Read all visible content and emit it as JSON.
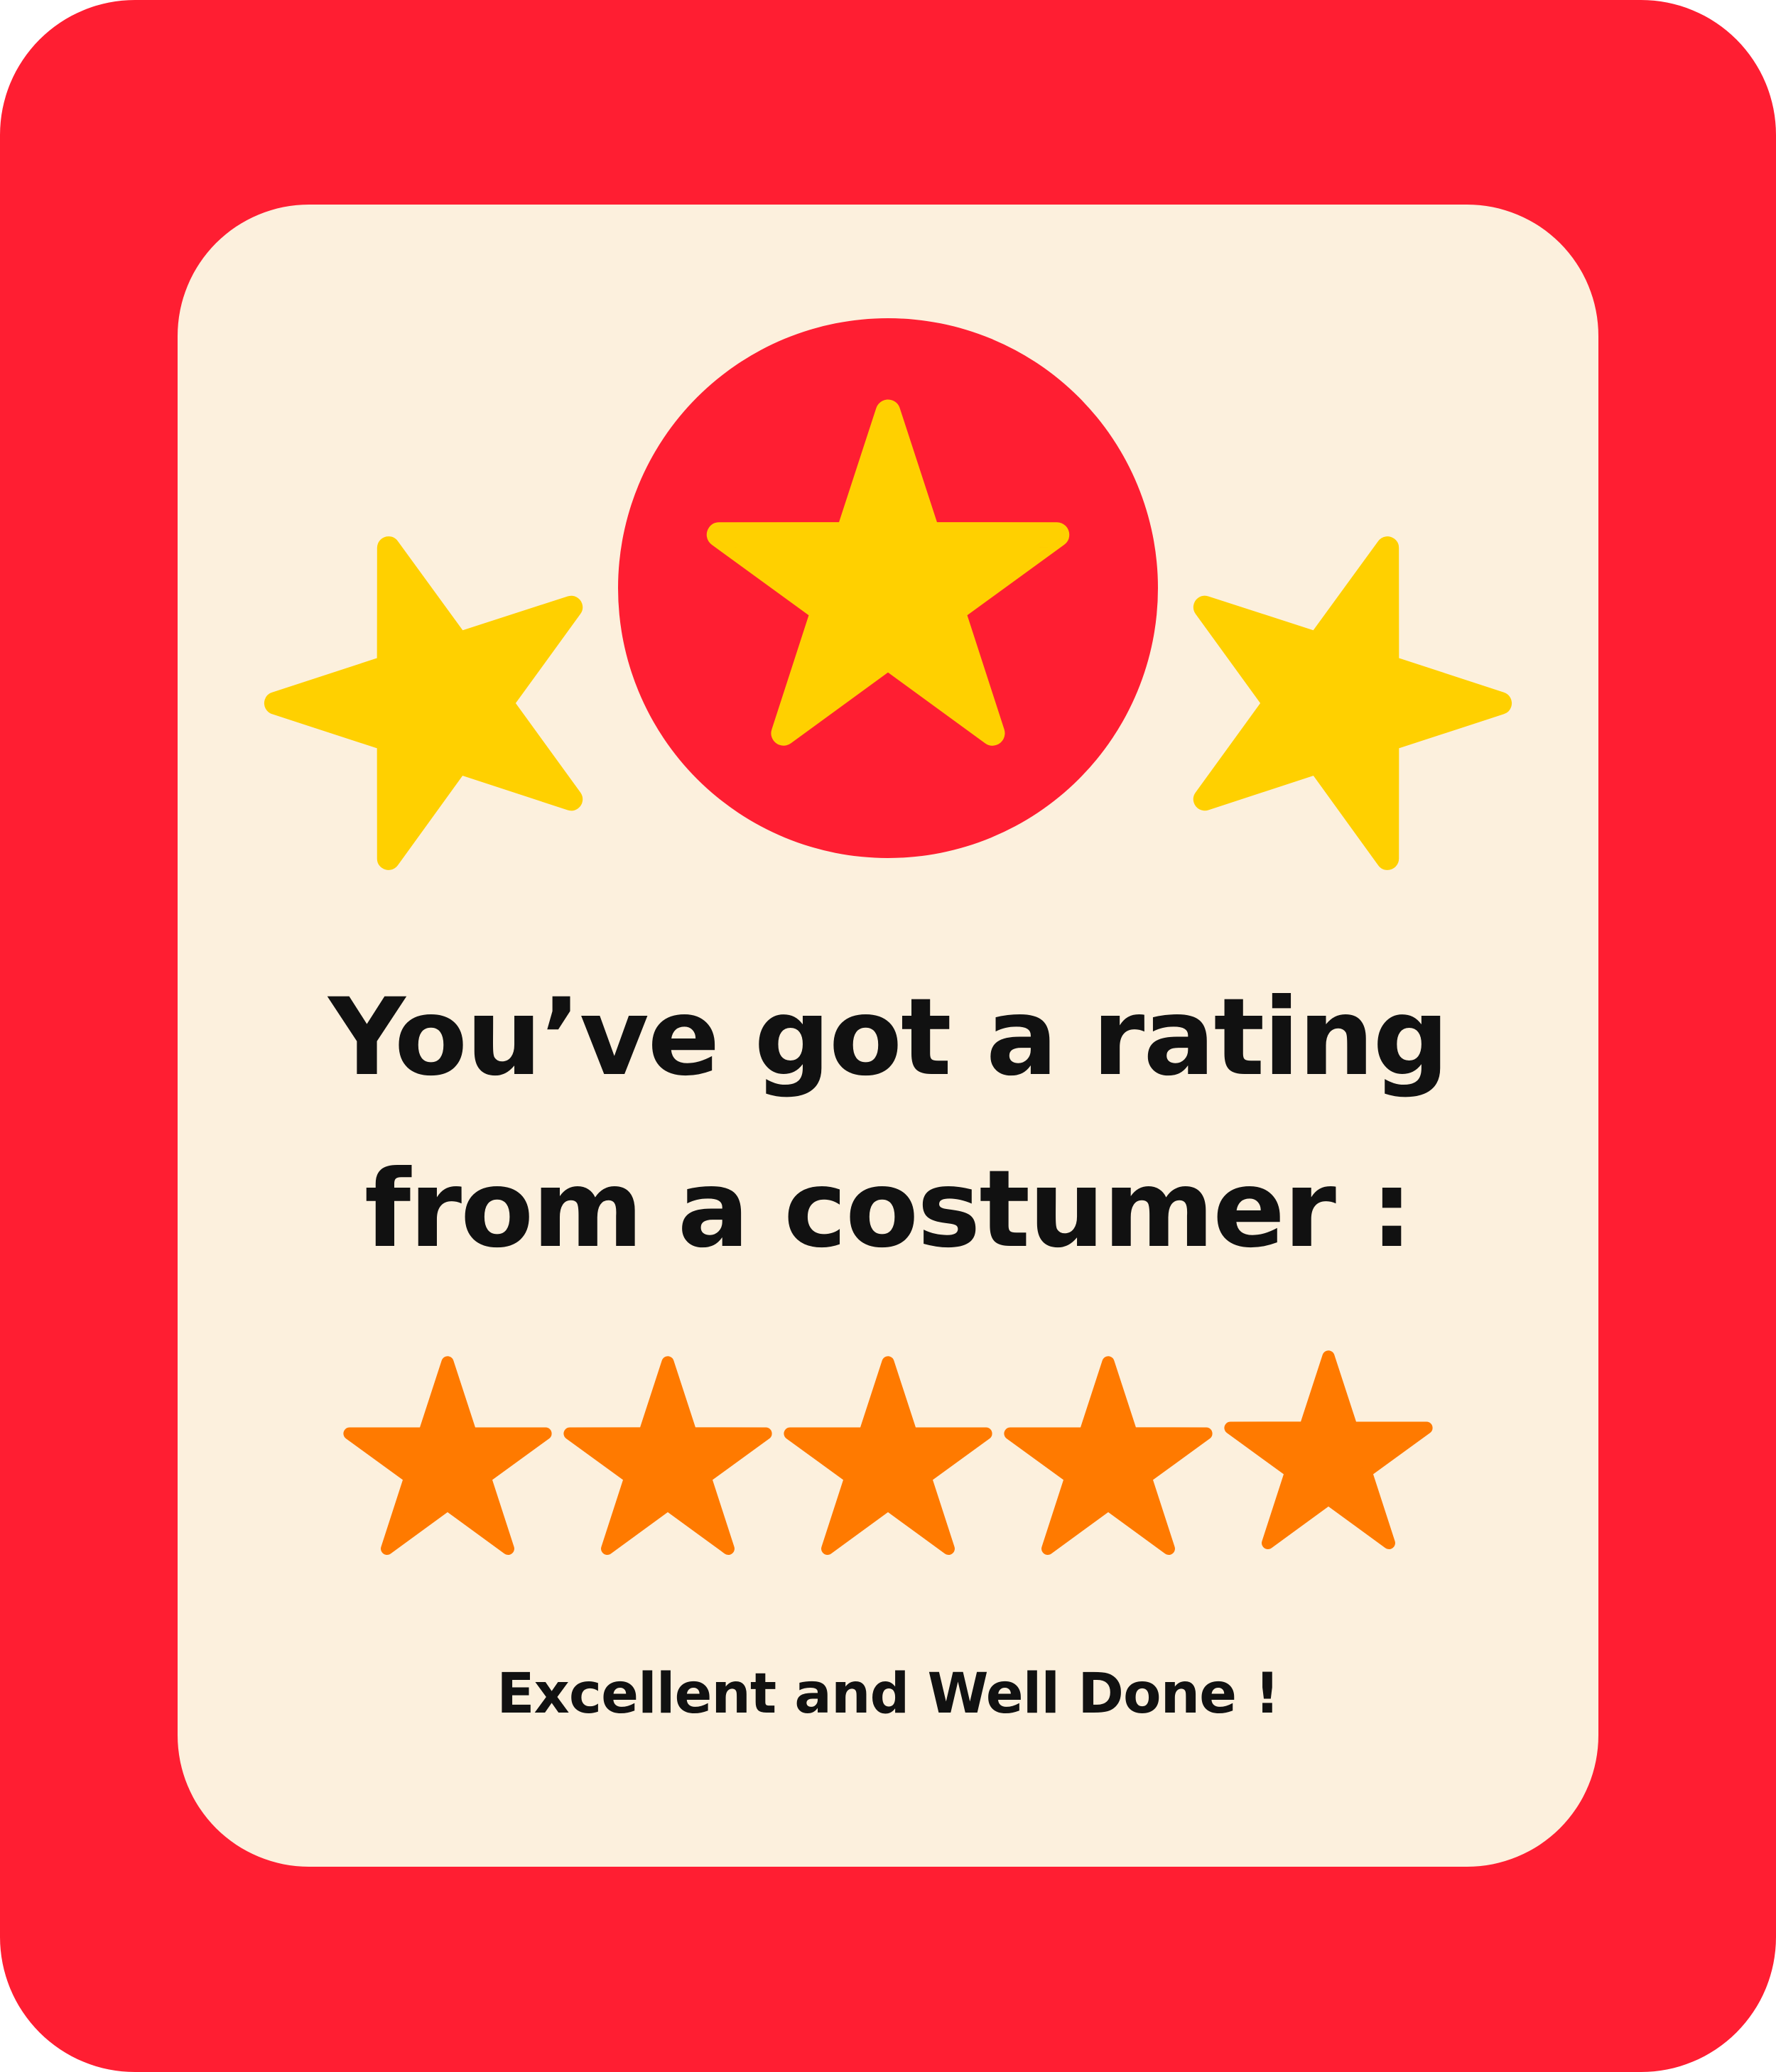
{
  "colors": {
    "frame": "#FF1E32",
    "card": "#FCF0DD",
    "hero_star": "#FFD000",
    "rating_star": "#FF7A00",
    "text": "#111111"
  },
  "hero": {
    "icon": "star-icon",
    "side_stars": 2
  },
  "headline": {
    "line1": "You’ve got a rating",
    "line2": "from a costumer :"
  },
  "rating": {
    "value": 5,
    "max": 5,
    "icon": "star-icon"
  },
  "tagline": "Excellent and Well Done !"
}
